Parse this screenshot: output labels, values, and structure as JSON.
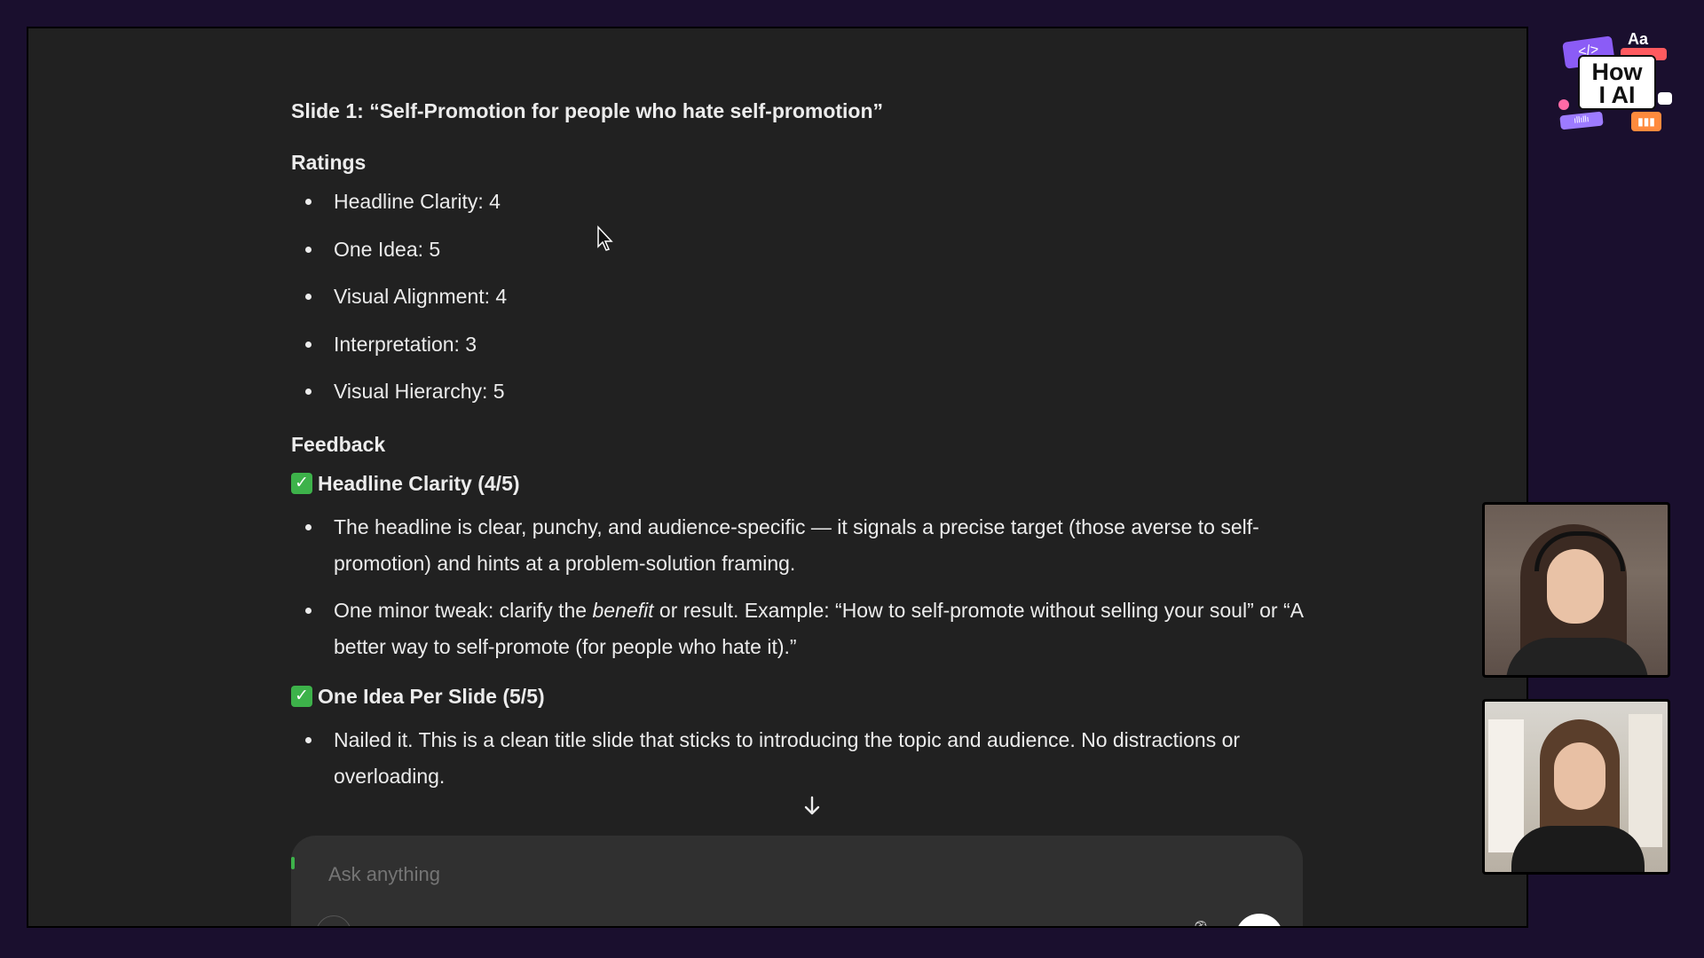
{
  "slide_heading": "Slide 1: “Self-Promotion for people who hate self-promotion”",
  "ratings": {
    "heading": "Ratings",
    "items": [
      "Headline Clarity: 4",
      "One Idea: 5",
      "Visual Alignment: 4",
      "Interpretation: 3",
      "Visual Hierarchy: 5"
    ]
  },
  "feedback": {
    "heading": "Feedback",
    "sections": [
      {
        "title": "Headline Clarity (4/5)",
        "bullets": [
          {
            "parts": [
              "The headline is clear, punchy, and audience-specific — it signals a precise target (those averse to self-promotion) and hints at a problem-solution framing."
            ]
          },
          {
            "before": "One minor tweak: clarify the ",
            "emph": "benefit",
            "after": " or result. Example: “How to self-promote without selling your soul” or “A better way to self-promote (for people who hate it).”"
          }
        ]
      },
      {
        "title": "One Idea Per Slide (5/5)",
        "bullets": [
          {
            "parts": [
              "Nailed it. This is a clean title slide that sticks to introducing the topic and audience. No distractions or overloading."
            ]
          }
        ]
      }
    ]
  },
  "composer": {
    "placeholder": "Ask anything",
    "scroll_icon": "arrow-down-icon",
    "plus_icon": "plus-icon",
    "mic_icon": "microphone-icon",
    "send_icon": "voice-send-icon"
  },
  "logo": {
    "aa": "Aa",
    "code": "</>",
    "title_line1": "How",
    "title_line2": "I AI"
  },
  "colors": {
    "screen_bg": "#212121",
    "frame_bg": "#1a0f2e",
    "check_green": "#3db24a",
    "text": "#ececec"
  }
}
